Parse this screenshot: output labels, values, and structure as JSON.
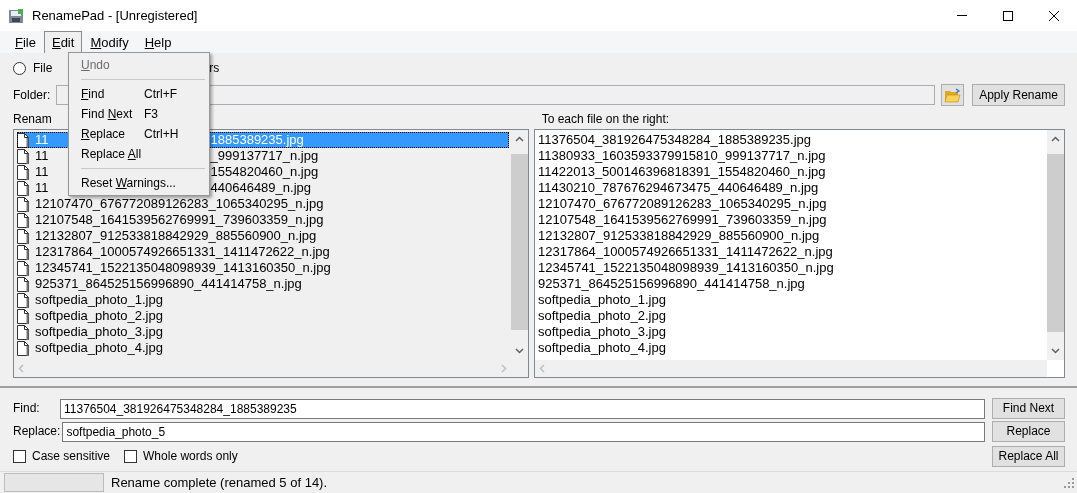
{
  "window": {
    "title": "RenamePad - [Unregistered]"
  },
  "menubar": [
    {
      "key": "F",
      "post": "ile",
      "selected": false
    },
    {
      "key": "E",
      "post": "dit",
      "selected": true
    },
    {
      "key": "M",
      "post": "odify",
      "selected": false
    },
    {
      "key": "H",
      "post": "elp",
      "selected": false
    }
  ],
  "mode_radio": {
    "label_start": "File",
    "label_end": "rs",
    "selected": false
  },
  "folder": {
    "label": "Folder:"
  },
  "apply_button": "Apply Rename",
  "left_list": {
    "label": "Renam",
    "rows": [
      {
        "start": "11",
        "end": "1885389235.jpg",
        "selected": true
      },
      {
        "start": "11",
        "end": "_999137717_n.jpg",
        "selected": false
      },
      {
        "start": "11",
        "end": "1554820460_n.jpg",
        "selected": false
      },
      {
        "start": "11",
        "end": "440646489_n.jpg",
        "selected": false
      },
      {
        "start": "12107470_676772089126283_1065340295_n.jpg",
        "selected": false
      },
      {
        "start": "12107548_1641539562769991_739603359_n.jpg",
        "selected": false
      },
      {
        "start": "12132807_912533818842929_885560900_n.jpg",
        "selected": false
      },
      {
        "start": "12317864_1000574926651331_1411472622_n.jpg",
        "selected": false
      },
      {
        "start": "12345741_1522135048098939_1413160350_n.jpg",
        "selected": false
      },
      {
        "start": "925371_864525156996890_441414758_n.jpg",
        "selected": false
      },
      {
        "start": "softpedia_photo_1.jpg",
        "selected": false
      },
      {
        "start": "softpedia_photo_2.jpg",
        "selected": false
      },
      {
        "start": "softpedia_photo_3.jpg",
        "selected": false
      },
      {
        "start": "softpedia_photo_4.jpg",
        "selected": false
      }
    ]
  },
  "right_list": {
    "label": "To each file on the right:",
    "rows": [
      "11376504_381926475348284_1885389235.jpg",
      "11380933_1603593379915810_999137717_n.jpg",
      "11422013_500146396818391_1554820460_n.jpg",
      "11430210_787676294673475_440646489_n.jpg",
      "12107470_676772089126283_1065340295_n.jpg",
      "12107548_1641539562769991_739603359_n.jpg",
      "12132807_912533818842929_885560900_n.jpg",
      "12317864_1000574926651331_1411472622_n.jpg",
      "12345741_1522135048098939_1413160350_n.jpg",
      "925371_864525156996890_441414758_n.jpg",
      "softpedia_photo_1.jpg",
      "softpedia_photo_2.jpg",
      "softpedia_photo_3.jpg",
      "softpedia_photo_4.jpg"
    ]
  },
  "find": {
    "label": "Find:",
    "value": "11376504_381926475348284_1885389235"
  },
  "replace": {
    "label": "Replace:",
    "value": "softpedia_photo_5"
  },
  "options": [
    {
      "label": "Case sensitive",
      "checked": false
    },
    {
      "label": "Whole words only",
      "checked": false
    }
  ],
  "buttons": [
    "Find Next",
    "Replace",
    "Replace All"
  ],
  "status": {
    "progress": {
      "level": 0
    },
    "text": "Rename complete (renamed 5 of 14)."
  },
  "edit_menu": [
    {
      "kind": "item",
      "key": "U",
      "post": "ndo",
      "disabled": true
    },
    {
      "kind": "separator"
    },
    {
      "kind": "item",
      "key": "F",
      "post": "ind",
      "shortcut": "Ctrl+F",
      "disabled": false
    },
    {
      "kind": "item",
      "pre": "Find ",
      "key": "N",
      "post": "ext",
      "shortcut": "F3",
      "disabled": false
    },
    {
      "kind": "item",
      "key": "R",
      "post": "eplace",
      "shortcut": "Ctrl+H",
      "disabled": false
    },
    {
      "kind": "item",
      "pre": "Replace ",
      "key": "A",
      "post": "ll",
      "disabled": false
    },
    {
      "kind": "separator"
    },
    {
      "kind": "item",
      "pre": "Reset ",
      "key": "W",
      "post": "arnings...",
      "disabled": false
    }
  ]
}
